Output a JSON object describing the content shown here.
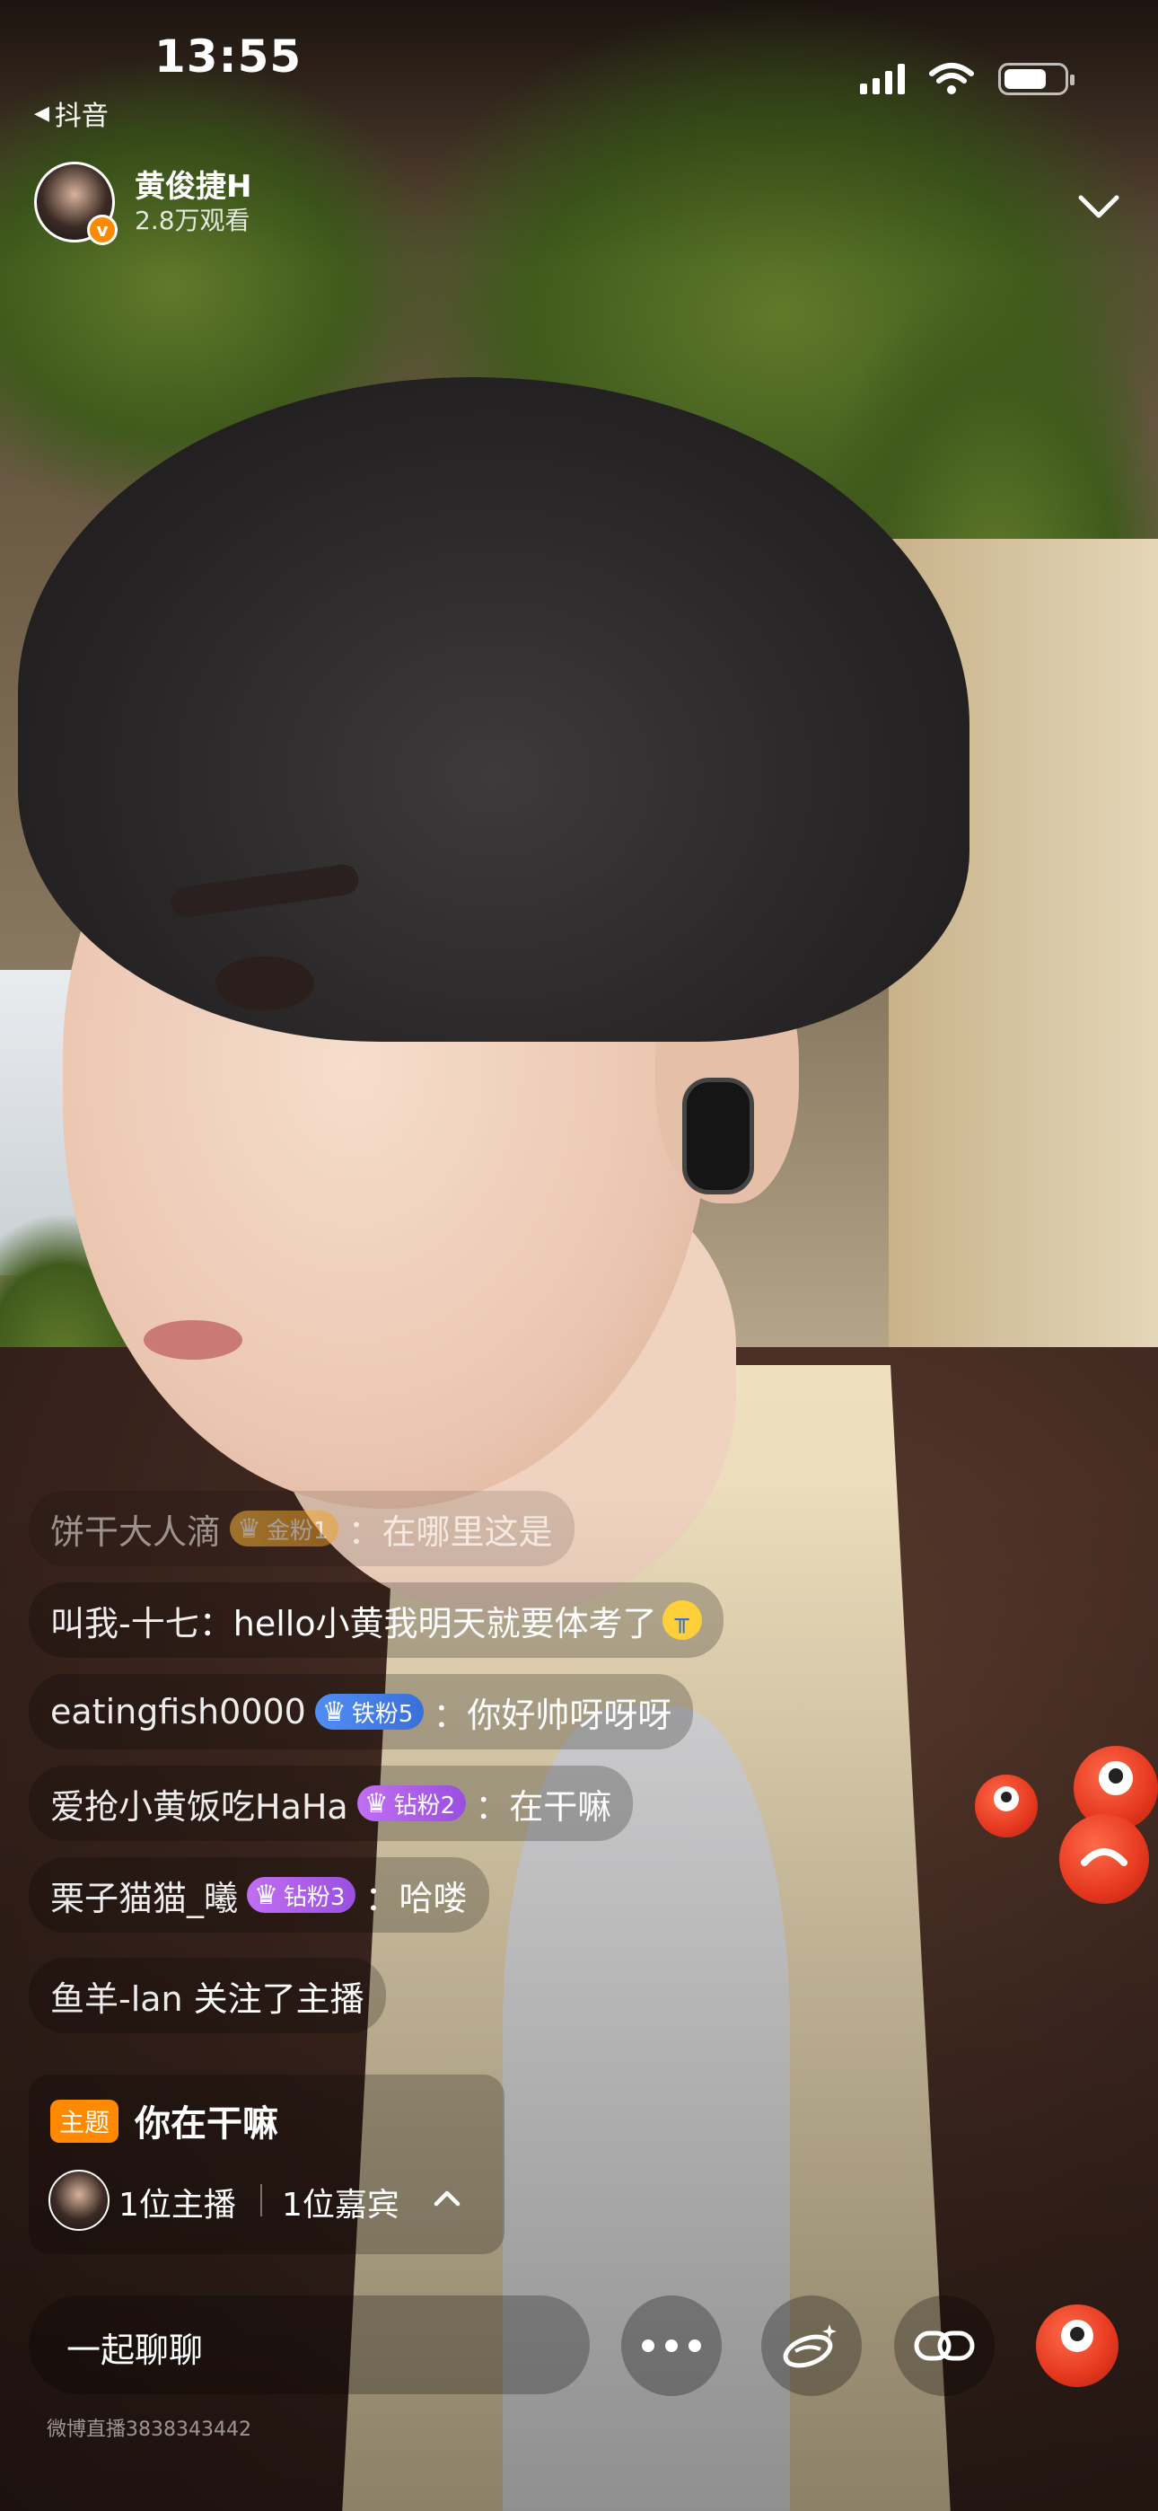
{
  "status_bar": {
    "time": "13:55",
    "back_app": "抖音"
  },
  "streamer": {
    "name": "黄俊捷H",
    "viewers": "2.8万观看"
  },
  "comments": [
    {
      "user": "饼干大人滴",
      "badge": "金粉1",
      "badge_color": "#f0b23a",
      "sep": "：",
      "message": "在哪里这是"
    },
    {
      "user": "叫我-十七",
      "sep": "：",
      "message": "hello小黄我明天就要体考了"
    },
    {
      "user": "eatingfish0000",
      "badge": "铁粉5",
      "badge_color": "#4f8ef3",
      "sep": "：",
      "message": "你好帅呀呀呀"
    },
    {
      "user": "爱抢小黄饭吃HaHa",
      "badge": "钻粉2",
      "badge_color": "#c06ff0",
      "sep": "：",
      "message": "在干嘛"
    },
    {
      "user": "栗子猫猫_曦",
      "badge": "钻粉3",
      "badge_color": "#c06ff0",
      "sep": "：",
      "message": "哈喽"
    },
    {
      "user": "鱼羊-lan",
      "message": "关注了主播"
    }
  ],
  "topic": {
    "tag": "主题",
    "text": "你在干嘛",
    "hosts": "1位主播",
    "guests": "1位嘉宾"
  },
  "bottom_bar": {
    "chat_placeholder": "一起聊聊",
    "icons": [
      "more-icon",
      "beauty-icon",
      "link-icon",
      "gift-icon"
    ]
  },
  "watermark": "微博直播3838343442",
  "colors": {
    "accent_orange": "#ff8a00",
    "sticker_red": "#e5381f"
  }
}
